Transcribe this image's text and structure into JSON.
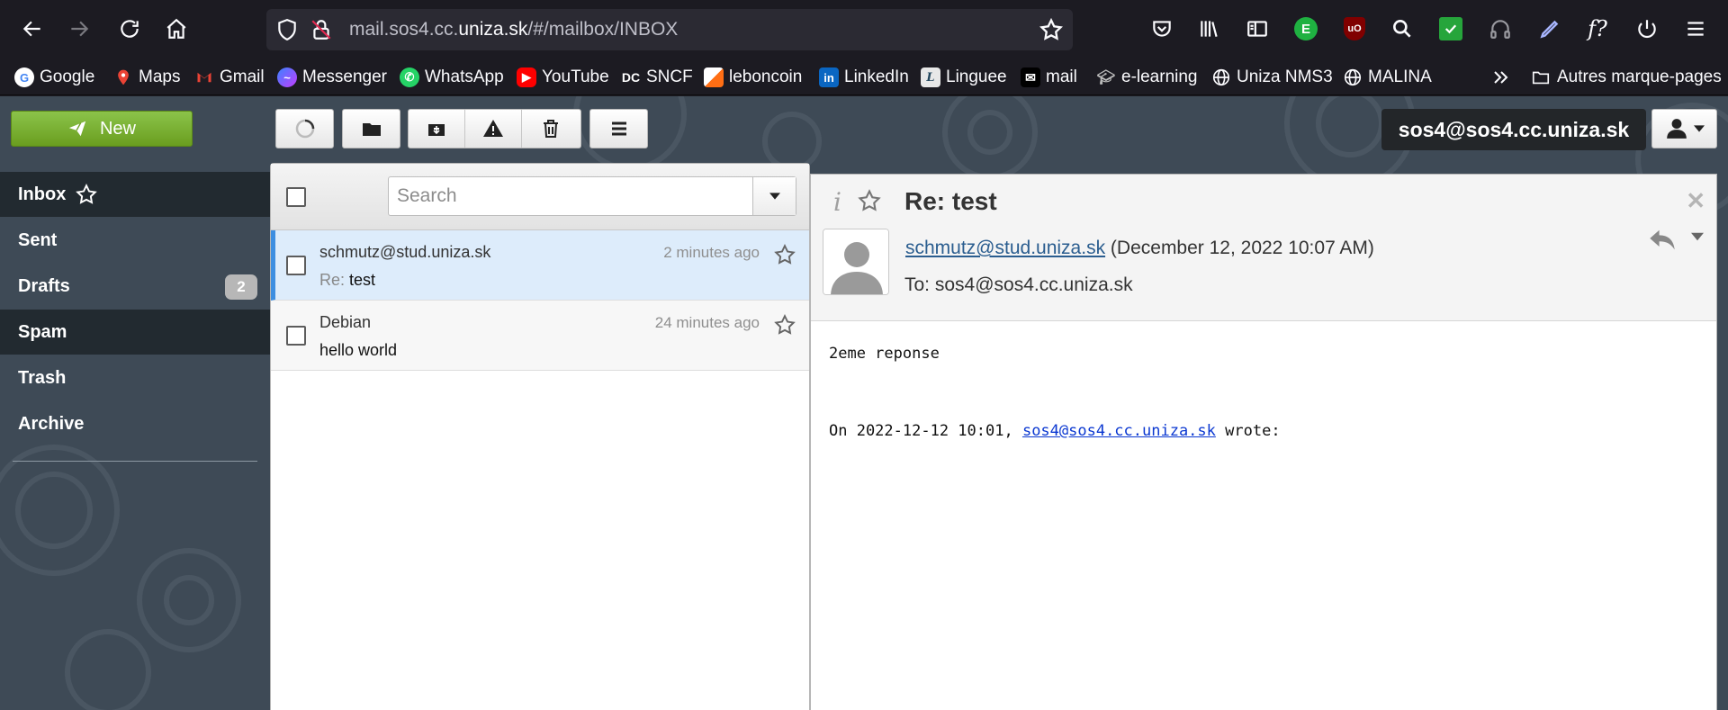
{
  "browser": {
    "url_prefix": "mail.sos4.cc.",
    "url_domain": "uniza.sk",
    "url_path": "/#/mailbox/INBOX"
  },
  "bookmarks": [
    {
      "label": "Google",
      "icon": "google-icon",
      "color": "#4285f4"
    },
    {
      "label": "Maps",
      "icon": "maps-pin-icon",
      "color": "#34a853"
    },
    {
      "label": "Gmail",
      "icon": "gmail-icon",
      "color": "#ea4335"
    },
    {
      "label": "Messenger",
      "icon": "messenger-icon",
      "color": "#8f46ff"
    },
    {
      "label": "WhatsApp",
      "icon": "whatsapp-icon",
      "color": "#25d366"
    },
    {
      "label": "YouTube",
      "icon": "youtube-icon",
      "color": "#ff0000"
    },
    {
      "label": "SNCF",
      "icon": "sncf-icon",
      "color": "#ffffff"
    },
    {
      "label": "leboncoin",
      "icon": "leboncoin-icon",
      "color": "#ff6e14"
    },
    {
      "label": "LinkedIn",
      "icon": "linkedin-icon",
      "color": "#0a66c2"
    },
    {
      "label": "Linguee",
      "icon": "linguee-icon",
      "color": "#23475e"
    },
    {
      "label": "mail",
      "icon": "mail-app-icon",
      "color": "#000000"
    },
    {
      "label": "e-learning",
      "icon": "graduation-cap-icon",
      "color": "#888888"
    },
    {
      "label": "Uniza NMS3",
      "icon": "globe-icon",
      "color": "#fbfbfe"
    },
    {
      "label": "MALINA",
      "icon": "globe-icon",
      "color": "#fbfbfe"
    }
  ],
  "other_bookmarks_label": "Autres marque-pages",
  "mail": {
    "new_button": "New",
    "account": "sos4@sos4.cc.uniza.sk",
    "folders": [
      {
        "label": "Inbox"
      },
      {
        "label": "Sent"
      },
      {
        "label": "Drafts",
        "count": "2"
      },
      {
        "label": "Spam"
      },
      {
        "label": "Trash"
      },
      {
        "label": "Archive"
      }
    ],
    "search_placeholder": "Search",
    "messages": [
      {
        "from": "schmutz@stud.uniza.sk",
        "date": "2 minutes ago",
        "subject_prefix": "Re:",
        "subject": "test"
      },
      {
        "from": "Debian",
        "date": "24 minutes ago",
        "subject": "hello world"
      }
    ],
    "reading": {
      "subject": "Re: test",
      "from": "schmutz@stud.uniza.sk",
      "date": "(December 12, 2022 10:07 AM)",
      "to": "To: sos4@sos4.cc.uniza.sk",
      "body_line1": "2eme reponse",
      "quote_prefix": "On 2022-12-12 10:01,",
      "quote_email": "sos4@sos4.cc.uniza.sk",
      "quote_suffix": "wrote:"
    }
  },
  "colors": {
    "browser_bg": "#1c1b22",
    "app_bg": "#3e4a56",
    "new_button": "#7cb532",
    "selected_row": "#ddecfb",
    "link": "#2a5d8f"
  }
}
